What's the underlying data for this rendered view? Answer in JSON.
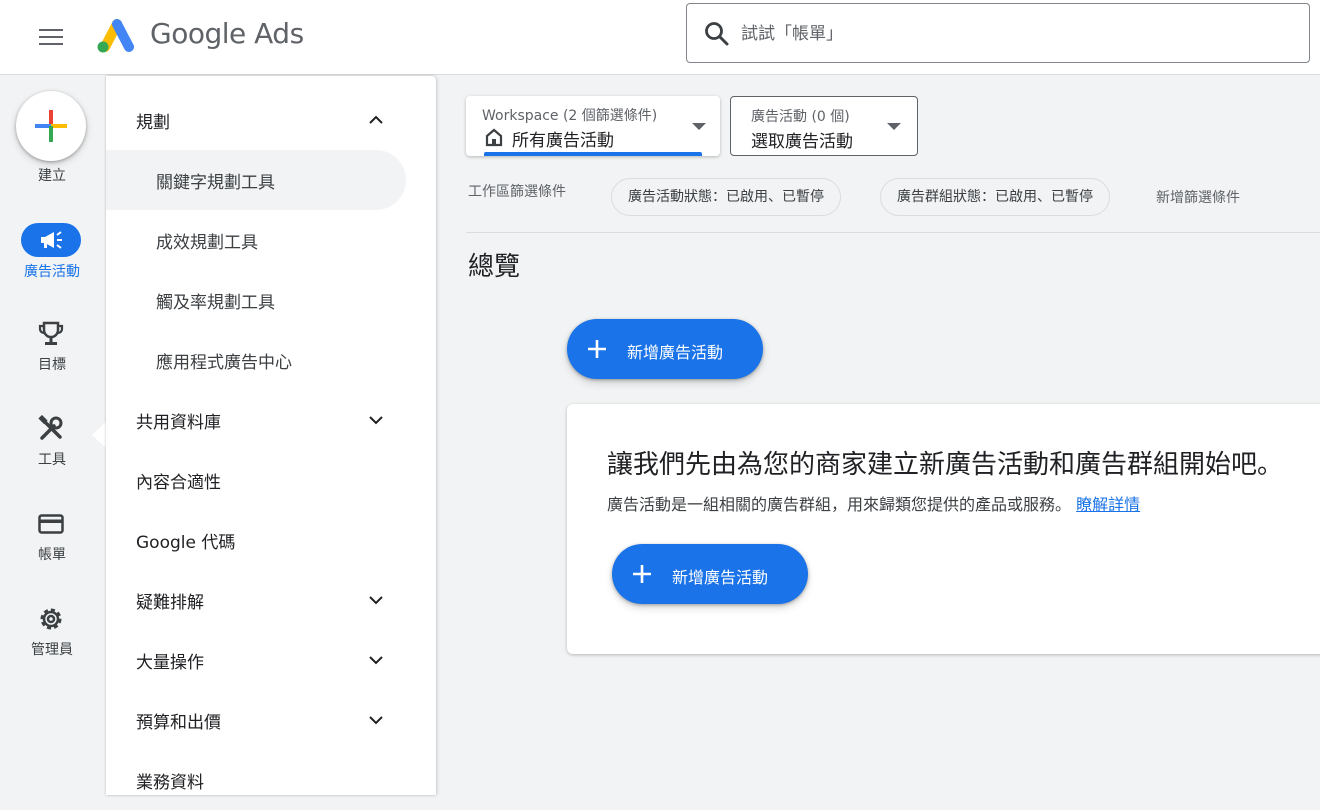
{
  "header": {
    "logo_text": "Google Ads",
    "search_placeholder": "試試「帳單」"
  },
  "rail": {
    "create_label": "建立",
    "items": [
      {
        "label": "廣告活動",
        "icon": "megaphone-icon",
        "active": true
      },
      {
        "label": "目標",
        "icon": "trophy-icon"
      },
      {
        "label": "工具",
        "icon": "tools-icon"
      },
      {
        "label": "帳單",
        "icon": "credit-card-icon"
      },
      {
        "label": "管理員",
        "icon": "gear-icon"
      }
    ]
  },
  "drawer": {
    "items": [
      {
        "label": "規劃",
        "level": "top",
        "expanded": true
      },
      {
        "label": "關鍵字規劃工具",
        "level": "sub",
        "active": true
      },
      {
        "label": "成效規劃工具",
        "level": "sub"
      },
      {
        "label": "觸及率規劃工具",
        "level": "sub"
      },
      {
        "label": "應用程式廣告中心",
        "level": "sub"
      },
      {
        "label": "共用資料庫",
        "level": "top",
        "expandable": true
      },
      {
        "label": "內容合適性",
        "level": "top"
      },
      {
        "label": "Google 代碼",
        "level": "top"
      },
      {
        "label": "疑難排解",
        "level": "top",
        "expandable": true
      },
      {
        "label": "大量操作",
        "level": "top",
        "expandable": true
      },
      {
        "label": "預算和出價",
        "level": "top",
        "expandable": true
      },
      {
        "label": "業務資料",
        "level": "top"
      }
    ]
  },
  "main": {
    "workspace_select": {
      "caption": "Workspace (2 個篩選條件)",
      "value": "所有廣告活動"
    },
    "campaign_select": {
      "caption": "廣告活動 (0 個)",
      "value": "選取廣告活動"
    },
    "filters": {
      "label": "工作區篩選條件",
      "chips": [
        "廣告活動狀態：已啟用、已暫停",
        "廣告群組狀態：已啟用、已暫停"
      ],
      "add_label": "新增篩選條件"
    },
    "overview_title": "總覽",
    "new_campaign_label": "新增廣告活動",
    "card": {
      "title": "讓我們先由為您的商家建立新廣告活動和廣告群組開始吧。",
      "description": "廣告活動是一組相關的廣告群組，用來歸類您提供的產品或服務。",
      "link": "瞭解詳情",
      "button_label": "新增廣告活動"
    }
  },
  "colors": {
    "accent": "#1a73e8",
    "background": "#f1f3f4"
  }
}
